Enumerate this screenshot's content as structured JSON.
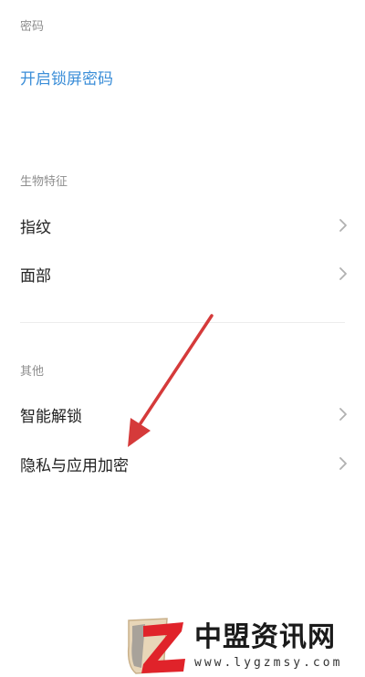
{
  "password_section": {
    "header": "密码",
    "enable_lock_password": "开启锁屏密码"
  },
  "biometrics_section": {
    "header": "生物特征",
    "items": [
      {
        "label": "指纹"
      },
      {
        "label": "面部"
      }
    ]
  },
  "other_section": {
    "header": "其他",
    "items": [
      {
        "label": "智能解锁"
      },
      {
        "label": "隐私与应用加密"
      }
    ]
  },
  "watermark": {
    "site_name": "中盟资讯网",
    "url": "www.lygzmsy.com"
  },
  "icons": {
    "chevron": "chevron-right-icon",
    "arrow": "annotation-arrow"
  },
  "colors": {
    "link": "#3b8ed8",
    "arrow": "#d53a3a",
    "header": "#8e8e8e"
  }
}
